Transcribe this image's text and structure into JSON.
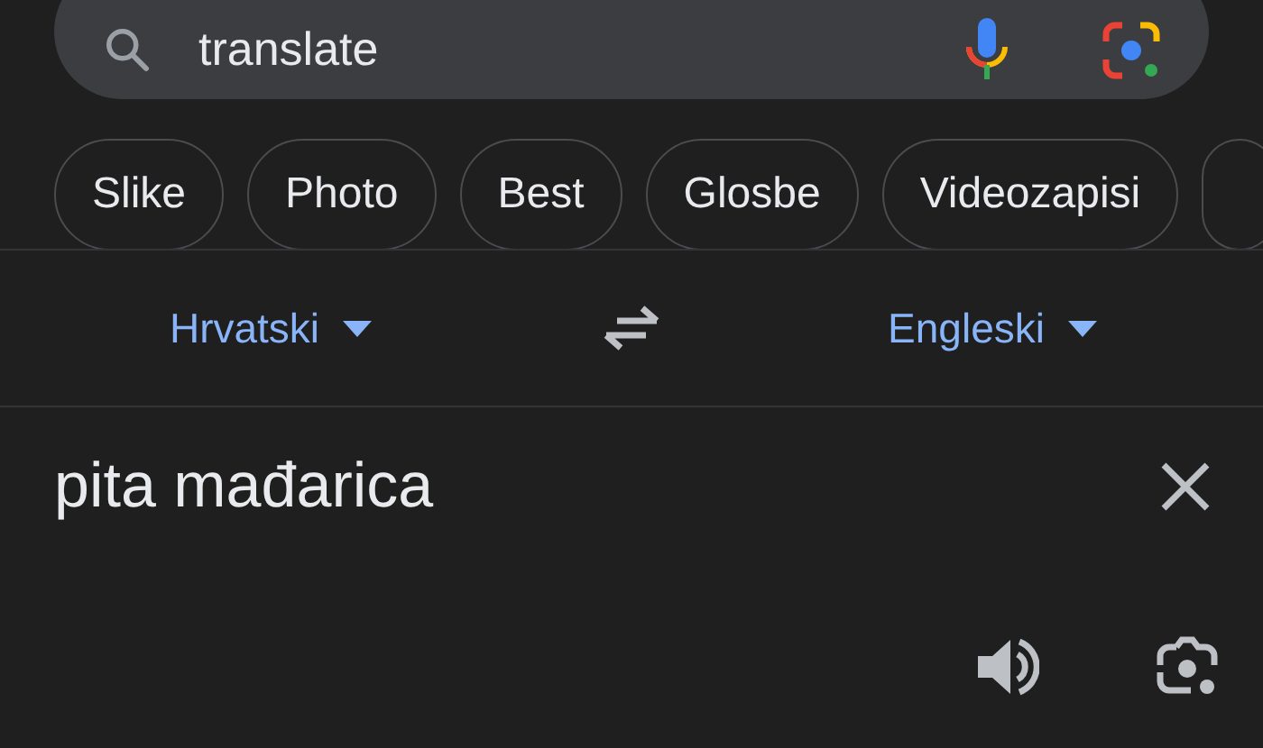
{
  "search": {
    "value": "translate"
  },
  "chips": [
    {
      "label": "Slike"
    },
    {
      "label": "Photo"
    },
    {
      "label": "Best"
    },
    {
      "label": "Glosbe"
    },
    {
      "label": "Videozapisi"
    }
  ],
  "translator": {
    "source_language": "Hrvatski",
    "target_language": "Engleski",
    "input": {
      "value": "pita mađarica"
    }
  }
}
